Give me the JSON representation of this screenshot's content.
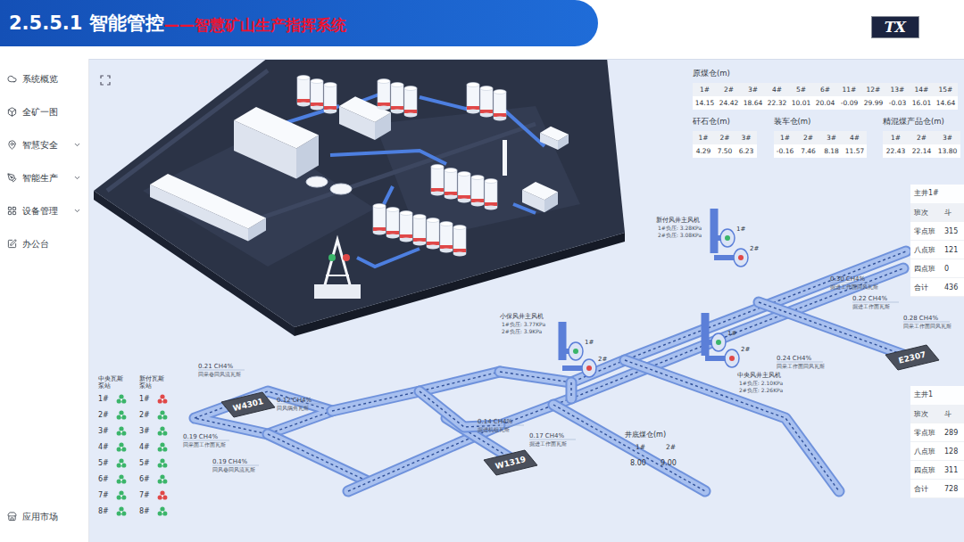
{
  "header": {
    "section": "2.5.5.1 智能管控",
    "subtitle": "——智慧矿山生产指挥系统",
    "logo": "TX"
  },
  "sidebar": {
    "items": [
      {
        "label": "系统概览",
        "expandable": false,
        "selected": false
      },
      {
        "label": "全矿一图",
        "expandable": false,
        "selected": false
      },
      {
        "label": "智慧安全",
        "expandable": true,
        "selected": false
      },
      {
        "label": "智能生产",
        "expandable": true,
        "selected": false
      },
      {
        "label": "设备管理",
        "expandable": true,
        "selected": false
      },
      {
        "label": "办公台",
        "expandable": false,
        "selected": false
      }
    ],
    "footer": "应用市场"
  },
  "bins": [
    {
      "title": "原煤仓(m)",
      "cells": [
        {
          "label": "1#",
          "value": "14.15"
        },
        {
          "label": "2#",
          "value": "24.42"
        },
        {
          "label": "3#",
          "value": "18.64"
        },
        {
          "label": "4#",
          "value": "22.32"
        },
        {
          "label": "5#",
          "value": "10.01"
        },
        {
          "label": "6#",
          "value": "20.04"
        },
        {
          "label": "11#",
          "value": "-0.09"
        },
        {
          "label": "12#",
          "value": "29.99"
        },
        {
          "label": "13#",
          "value": "-0.03"
        },
        {
          "label": "14#",
          "value": "16.01"
        },
        {
          "label": "15#",
          "value": "14.64"
        }
      ]
    },
    {
      "title": "矸石仓(m)",
      "cells": [
        {
          "label": "1#",
          "value": "4.29"
        },
        {
          "label": "2#",
          "value": "7.50"
        },
        {
          "label": "3#",
          "value": "6.23"
        }
      ]
    },
    {
      "title": "装车仓(m)",
      "cells": [
        {
          "label": "1#",
          "value": "-0.16"
        },
        {
          "label": "2#",
          "value": "7.46"
        },
        {
          "label": "3#",
          "value": "8.18"
        },
        {
          "label": "4#",
          "value": "11.57"
        }
      ]
    },
    {
      "title": "精混煤产品仓(m)",
      "cells": [
        {
          "label": "1#",
          "value": "22.43"
        },
        {
          "label": "2#",
          "value": "22.14"
        },
        {
          "label": "3#",
          "value": "13.80"
        }
      ]
    }
  ],
  "shafts": [
    {
      "title": "主井1#",
      "columns": [
        "班次",
        "斗"
      ],
      "rows": [
        {
          "shift": "零点班",
          "value": "315"
        },
        {
          "shift": "八点班",
          "value": "121"
        },
        {
          "shift": "四点班",
          "value": "0"
        },
        {
          "shift": "合计",
          "value": "436"
        }
      ]
    },
    {
      "title": "主井1",
      "columns": [
        "班次",
        "斗"
      ],
      "rows": [
        {
          "shift": "零点班",
          "value": "289"
        },
        {
          "shift": "八点班",
          "value": "128"
        },
        {
          "shift": "四点班",
          "value": "311"
        },
        {
          "shift": "合计",
          "value": "728"
        }
      ]
    }
  ],
  "diagram": {
    "faces": [
      "W4301",
      "W1319",
      "E2307"
    ],
    "fans": [
      {
        "name": "新付风井主风机",
        "readings": [
          "1#负压: 3.28KPa",
          "2#负压: 3.08KPa"
        ],
        "units": [
          {
            "label": "1#",
            "running": true
          },
          {
            "label": "2#",
            "running": false
          }
        ]
      },
      {
        "name": "小保风井主风机",
        "readings": [
          "1#负压: 3.77KPa",
          "2#负压: 3.9KPa"
        ],
        "units": [
          {
            "label": "1#",
            "running": true
          },
          {
            "label": "2#",
            "running": false
          }
        ]
      },
      {
        "name": "中央风井主风机",
        "readings": [
          "1#负压: 2.10KPa",
          "2#负压: 2.26KPa"
        ],
        "units": [
          {
            "label": "1#",
            "running": true
          },
          {
            "label": "2#",
            "running": false
          }
        ]
      }
    ],
    "gas": [
      {
        "value": "0.21 CH4%",
        "note": "回采巷回风流瓦斯"
      },
      {
        "value": "0.12 CH4%",
        "note": "回风隅角瓦斯"
      },
      {
        "value": "0.19 CH4%",
        "note": "回采面工作面瓦斯"
      },
      {
        "value": "0.19 CH4%",
        "note": "回风巷回风流瓦斯"
      },
      {
        "value": "0.14 CH4%",
        "note": "掘进机组瓦斯"
      },
      {
        "value": "0.17 CH4%",
        "note": "掘进工作面瓦斯"
      },
      {
        "value": "0.30 CH4%",
        "note": "掘进工作面回风瓦斯"
      },
      {
        "value": "0.22 CH4%",
        "note": "掘进工作面瓦斯"
      },
      {
        "value": "0.24 CH4%",
        "note": "回采工作面回风瓦斯"
      },
      {
        "value": "0.28 CH4%",
        "note": "回采工作面回风瓦斯"
      }
    ],
    "shaft_bin": {
      "title": "井底煤仓(m)",
      "cells": [
        {
          "label": "1#",
          "value": "8.00"
        },
        {
          "label": "2#",
          "value": "9.00"
        }
      ]
    }
  },
  "pumps": {
    "stations": [
      "中央瓦斯泵站",
      "新付瓦斯泵站"
    ],
    "rows": [
      {
        "label": "1#",
        "units": [
          {
            "running": true
          },
          {
            "running": false
          }
        ]
      },
      {
        "label": "2#",
        "units": [
          {
            "running": true
          },
          {
            "running": true
          }
        ]
      },
      {
        "label": "3#",
        "units": [
          {
            "running": true
          },
          {
            "running": true
          }
        ]
      },
      {
        "label": "4#",
        "units": [
          {
            "running": true
          },
          {
            "running": true
          }
        ]
      },
      {
        "label": "5#",
        "units": [
          {
            "running": true
          },
          {
            "running": true
          }
        ]
      },
      {
        "label": "6#",
        "units": [
          {
            "running": true
          },
          {
            "running": true
          }
        ]
      },
      {
        "label": "7#",
        "units": [
          {
            "running": true
          },
          {
            "running": false
          }
        ]
      },
      {
        "label": "8#",
        "units": [
          {
            "running": true
          },
          {
            "running": true
          }
        ]
      }
    ]
  }
}
